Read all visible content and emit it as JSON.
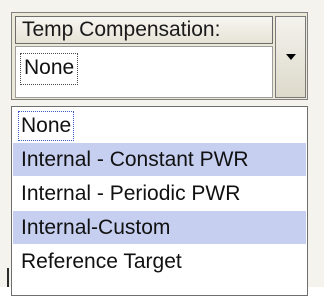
{
  "combo": {
    "label": "Temp Compensation:",
    "value": "None"
  },
  "list": {
    "items": [
      {
        "label": "None",
        "highlighted": false,
        "focused": true
      },
      {
        "label": "Internal - Constant PWR",
        "highlighted": true,
        "focused": false
      },
      {
        "label": "Internal - Periodic PWR",
        "highlighted": false,
        "focused": false
      },
      {
        "label": "Internal-Custom",
        "highlighted": true,
        "focused": false
      },
      {
        "label": "Reference Target",
        "highlighted": false,
        "focused": false
      }
    ]
  },
  "icons": {
    "dropdown": "chevron-down-icon"
  },
  "colors": {
    "highlight": "#c6cff0",
    "window_bg": "#ece9d8"
  }
}
